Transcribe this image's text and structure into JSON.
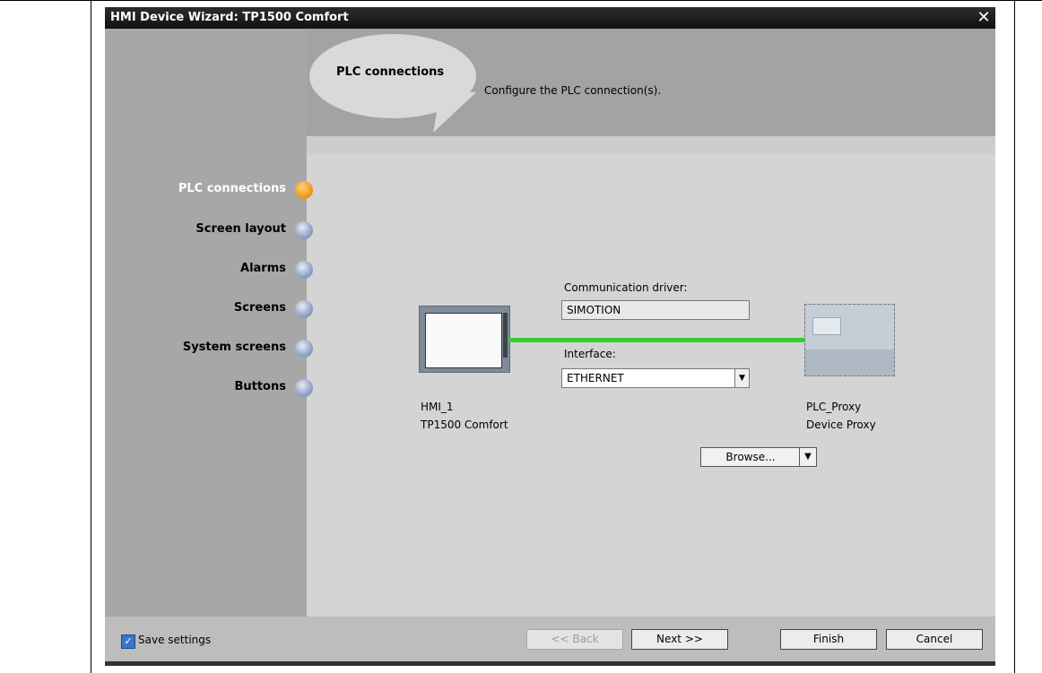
{
  "window": {
    "title": "HMI Device Wizard: TP1500 Comfort",
    "close_glyph": "✕"
  },
  "header": {
    "bubble_title": "PLC connections",
    "subtitle": "Configure the PLC connection(s)."
  },
  "steps": [
    {
      "label": "PLC connections",
      "active": true
    },
    {
      "label": "Screen layout",
      "active": false
    },
    {
      "label": "Alarms",
      "active": false
    },
    {
      "label": "Screens",
      "active": false
    },
    {
      "label": "System screens",
      "active": false
    },
    {
      "label": "Buttons",
      "active": false
    }
  ],
  "connection": {
    "driver_label": "Communication driver:",
    "driver_value": "SIMOTION",
    "interface_label": "Interface:",
    "interface_value": "ETHERNET",
    "line_color": "#2fd12f"
  },
  "hmi": {
    "name": "HMI_1",
    "type": "TP1500 Comfort"
  },
  "plc": {
    "name": "PLC_Proxy",
    "type": "Device Proxy",
    "browse_label": "Browse..."
  },
  "footer": {
    "save_settings_label": "Save settings",
    "save_settings_checked": true,
    "back_label": "<< Back",
    "next_label": "Next >>",
    "finish_label": "Finish",
    "cancel_label": "Cancel"
  },
  "colors": {
    "active_step": "#f29c1e",
    "inactive_step": "#8fa2c8",
    "checkbox": "#3e74c9"
  }
}
